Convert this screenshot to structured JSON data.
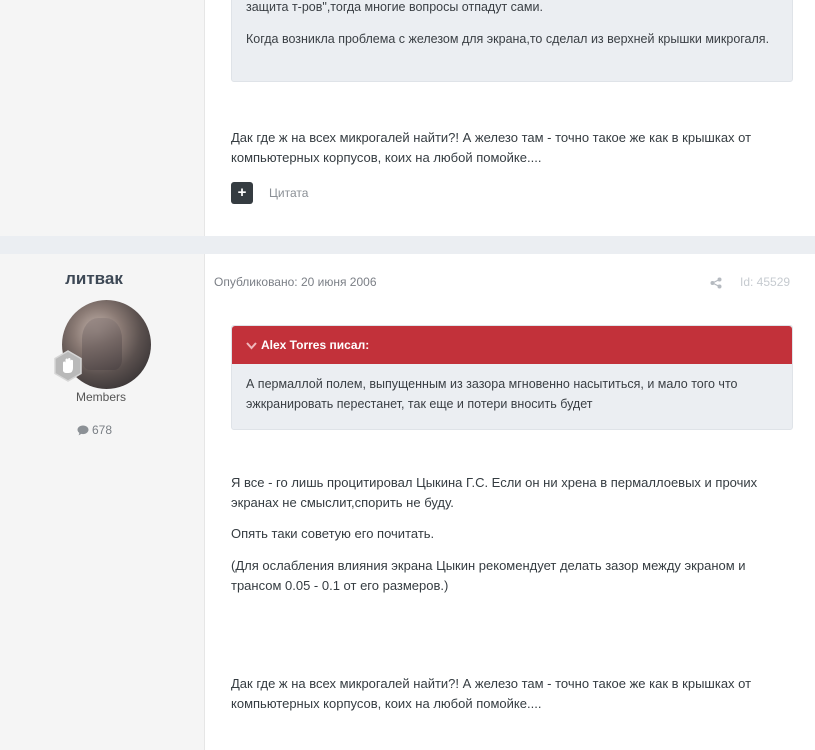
{
  "post1": {
    "quote_lines": [
      "защита т-ров\",тогда многие вопросы отпадут сами.",
      "Когда возникла проблема с железом для экрана,то сделал из верхней крышки микрогаля."
    ],
    "reply": "Дак где ж на всех микрогалей найти?! А железо там - точно такое же как в крышках от компьютерных корпусов, коих на любой помойке....",
    "cite_label": "Цитата"
  },
  "post2": {
    "author": "литвак",
    "group": "Members",
    "post_count": "678",
    "published": "Опубликовано: 20 июня 2006",
    "post_id": "Id: 45529",
    "quote_author": "Alex Torres писал:",
    "quote_text": "А пермаллой полем, выпущенным из зазора мгновенно насытиться, и мало того что эжкранировать перестанет, так еще и потери вносить будет",
    "paragraphs": [
      "Я все - го лишь процитировал Цыкина Г.С. Если он ни хрена в пермаллоевых и прочих экранах не смыслит,спорить не буду.",
      "Опять таки советую его почитать.",
      "(Для ослабления влияния экрана Цыкин рекомендует делать зазор между экраном и трансом 0.05 - 0.1 от его размеров.)",
      "Дак где ж на всех микрогалей найти?! А железо там - точно такое же как в крышках от компьютерных корпусов, коих на любой помойке...."
    ]
  },
  "colors": {
    "quote_header": "#c2313a",
    "quote_bg": "#ebeef2",
    "author_bg": "#f5f5f5"
  }
}
